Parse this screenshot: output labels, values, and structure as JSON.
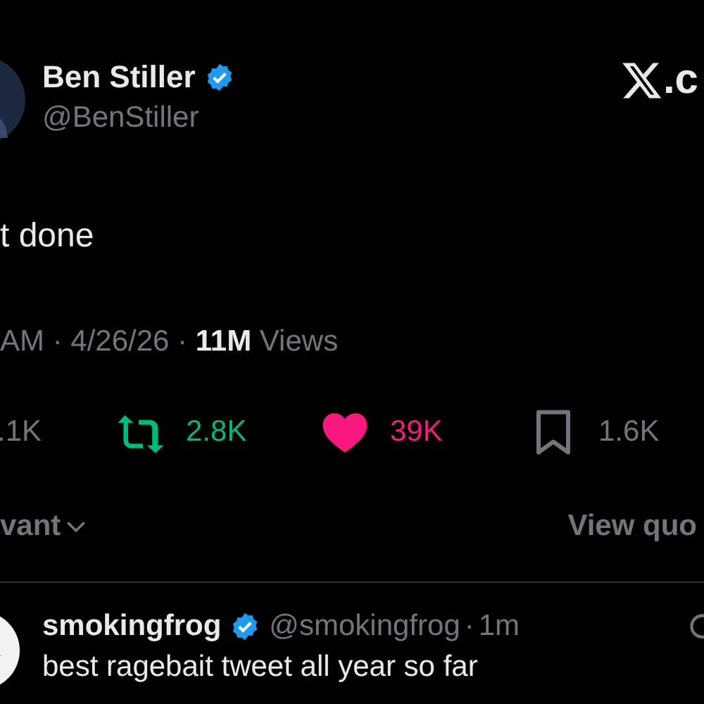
{
  "tweet": {
    "author": {
      "name": "Ben Stiller",
      "verified": true,
      "handle": "@BenStiller"
    },
    "site": ".c",
    "text": "t done",
    "meta": "AM · 4/26/26 · **11M** Views",
    "actions": [
      {
        "kind": "reply",
        "count": ".1K"
      },
      {
        "kind": "retweet",
        "count": "2.8K",
        "active": true
      },
      {
        "kind": "like",
        "count": "39K",
        "active": true
      },
      {
        "kind": "bookmark",
        "count": "1.6K",
        "active": false
      }
    ],
    "sort": "vant",
    "quotes_link": "View quo"
  },
  "replies": [
    {
      "name": "smokingfrog",
      "verified": true,
      "handle": "@smokingfrog",
      "separator": "·",
      "time": "1m",
      "text": "best ragebait tweet all year so far"
    }
  ]
}
